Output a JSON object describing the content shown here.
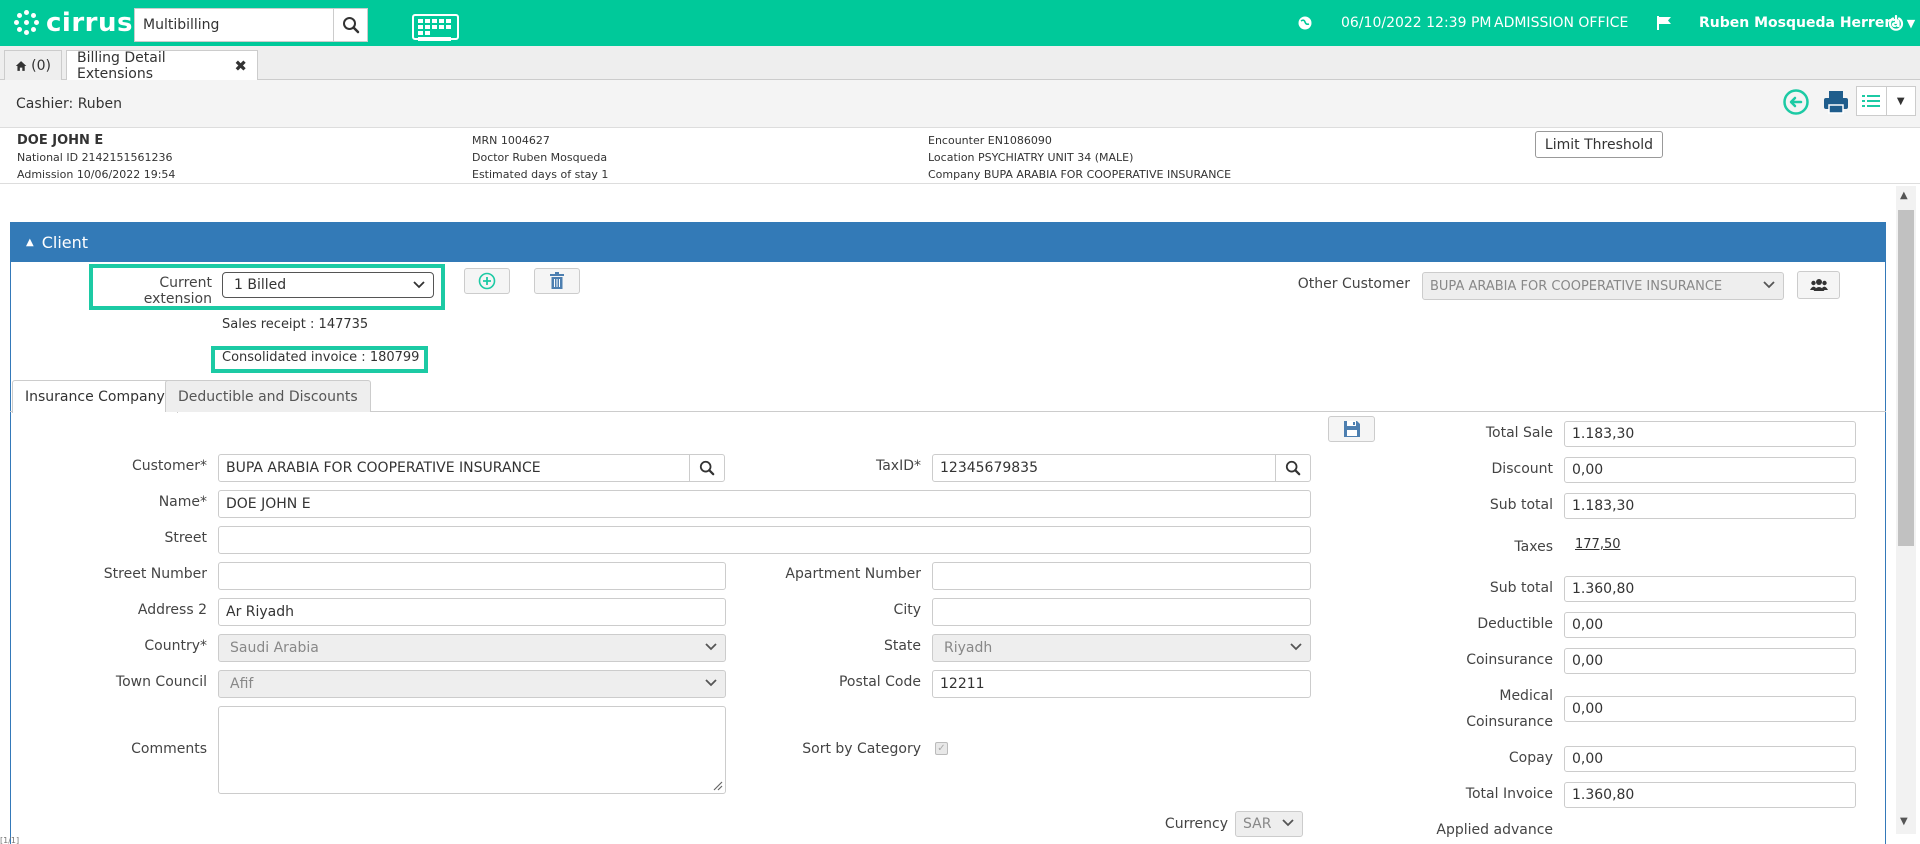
{
  "topbar": {
    "logo_text": "cirrus",
    "search_value": "Multibilling",
    "datetime": "06/10/2022 12:39 PM",
    "office": "ADMISSION OFFICE",
    "user_name": "Ruben Mosqueda Herrera",
    "bg_color": "#00c99a"
  },
  "tabs": {
    "home_label": "(0)",
    "billing_label": "Billing Detail Extensions",
    "close_glyph": "✖"
  },
  "header": {
    "cashier": "Cashier: Ruben"
  },
  "patient": {
    "name": "DOE JOHN E",
    "national_id_label": "National ID",
    "national_id": "2142151561236",
    "admission_label": "Admission",
    "admission": "10/06/2022 19:54",
    "mrn_label": "MRN",
    "mrn": "1004627",
    "doctor_label": "Doctor",
    "doctor": "Ruben Mosqueda",
    "stay_label": "Estimated days of stay",
    "stay": "1",
    "encounter_label": "Encounter",
    "encounter": "EN1086090",
    "location_label": "Location",
    "location": "PSYCHIATRY UNIT 34 (MALE)",
    "company_label": "Company",
    "company": "BUPA ARABIA FOR COOPERATIVE INSURANCE",
    "limit_button": "Limit Threshold"
  },
  "client": {
    "panel_title": "Client",
    "current_extension_label": "Current extension",
    "current_extension_value": "1 Billed",
    "sales_receipt": "Sales receipt : 147735",
    "consolidated_invoice": "Consolidated invoice : 180799",
    "other_customer_label": "Other Customer",
    "other_customer_value": "BUPA ARABIA FOR COOPERATIVE INSURANCE",
    "tab_insurance": "Insurance Company",
    "tab_deductible": "Deductible and Discounts",
    "customer_label": "Customer*",
    "customer_value": "BUPA ARABIA FOR COOPERATIVE INSURANCE",
    "taxid_label": "TaxID*",
    "taxid_value": "12345679835",
    "name_label": "Name*",
    "name_value": "DOE JOHN E",
    "street_label": "Street",
    "street_value": "",
    "street_number_label": "Street Number",
    "street_number_value": "",
    "apartment_label": "Apartment Number",
    "apartment_value": "",
    "address2_label": "Address 2",
    "address2_value": "Ar Riyadh",
    "city_label": "City",
    "city_value": "",
    "country_label": "Country*",
    "country_value": "Saudi Arabia",
    "state_label": "State",
    "state_value": "Riyadh",
    "town_label": "Town Council",
    "town_value": "Afif",
    "postal_label": "Postal Code",
    "postal_value": "12211",
    "comments_label": "Comments",
    "sort_label": "Sort by Category",
    "currency_label": "Currency",
    "currency_value": "SAR"
  },
  "totals": {
    "total_sale_label": "Total Sale",
    "total_sale": "1.183,30",
    "discount_label": "Discount",
    "discount": "0,00",
    "subtotal1_label": "Sub total",
    "subtotal1": "1.183,30",
    "taxes_label": "Taxes",
    "taxes": "177,50",
    "subtotal2_label": "Sub total",
    "subtotal2": "1.360,80",
    "deductible_label": "Deductible",
    "deductible": "0,00",
    "coinsurance_label": "Coinsurance",
    "coinsurance": "0,00",
    "medical_label_1": "Medical",
    "medical_label_2": "Coinsurance",
    "medical": "0,00",
    "copay_label": "Copay",
    "copay": "0,00",
    "total_invoice_label": "Total Invoice",
    "total_invoice": "1.360,80",
    "applied_advance_label": "Applied advance"
  },
  "footer": {
    "status": "[1/1]"
  }
}
